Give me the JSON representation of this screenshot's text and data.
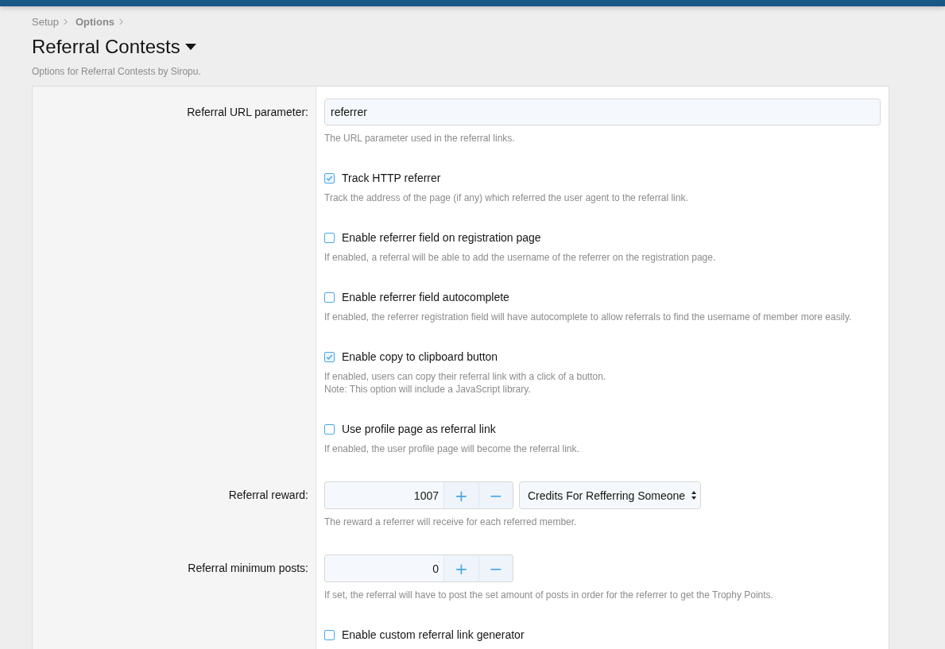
{
  "breadcrumb": [
    {
      "label": "Setup",
      "bold": false
    },
    {
      "label": "Options",
      "bold": true
    }
  ],
  "title": "Referral Contests",
  "description": "Options for Referral Contests by Siropu.",
  "options": [
    {
      "kind": "text",
      "label": "Referral URL parameter:",
      "value": "referrer",
      "hint": [
        "The URL parameter used in the referral links."
      ]
    },
    {
      "kind": "checkbox",
      "text": "Track HTTP referrer",
      "checked": true,
      "hint": [
        "Track the address of the page (if any) which referred the user agent to the referral link."
      ]
    },
    {
      "kind": "checkbox",
      "text": "Enable referrer field on registration page",
      "checked": false,
      "hint": [
        "If enabled, a referral will be able to add the username of the referrer on the registration page."
      ]
    },
    {
      "kind": "checkbox",
      "text": "Enable referrer field autocomplete",
      "checked": false,
      "hint": [
        "If enabled, the referrer registration field will have autocomplete to allow referrals to find the username of member more easily."
      ]
    },
    {
      "kind": "checkbox",
      "text": "Enable copy to clipboard button",
      "checked": true,
      "hint": [
        "If enabled, users can copy their referral link with a click of a button.",
        "Note: This option will include a JavaScript library."
      ]
    },
    {
      "kind": "checkbox",
      "text": "Use profile page as referral link",
      "checked": false,
      "hint": [
        "If enabled, the user profile page will become the referral link."
      ]
    },
    {
      "kind": "spinner",
      "label": "Referral reward:",
      "value": "1007",
      "plus": "+",
      "minus": "−",
      "select": "Credits For Refferring Someone",
      "hint": [
        "The reward a referrer will receive for each referred member."
      ]
    },
    {
      "kind": "spinner",
      "label": "Referral minimum posts:",
      "value": "0",
      "plus": "+",
      "minus": "−",
      "hint": [
        "If set, the referral will have to post the set amount of posts in order for the referrer to get the Trophy Points."
      ]
    },
    {
      "kind": "checkbox",
      "text": "Enable custom referral link generator",
      "checked": false
    }
  ]
}
